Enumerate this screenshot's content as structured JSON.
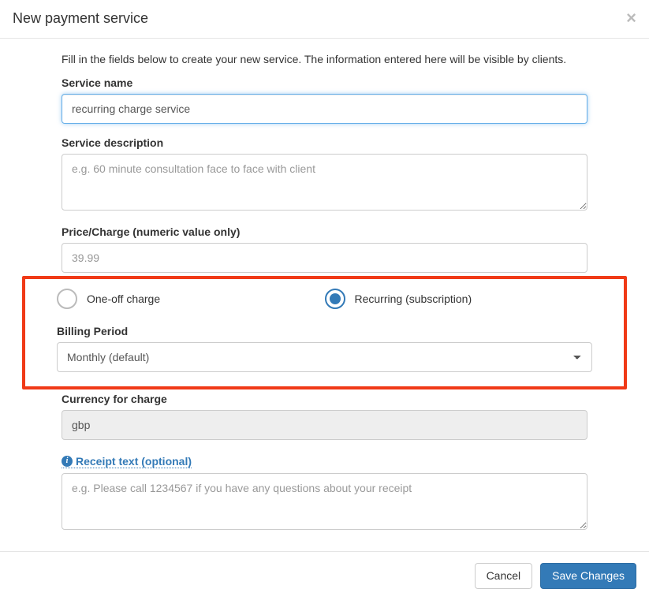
{
  "header": {
    "title": "New payment service",
    "close_glyph": "×"
  },
  "intro": "Fill in the fields below to create your new service. The information entered here will be visible by clients.",
  "svc_name": {
    "label": "Service name",
    "value": "recurring charge service"
  },
  "svc_desc": {
    "label": "Service description",
    "placeholder": "e.g. 60 minute consultation face to face with client",
    "value": ""
  },
  "price": {
    "label": "Price/Charge (numeric value only)",
    "placeholder": "39.99",
    "value": ""
  },
  "charge_type": {
    "one_off_label": "One-off charge",
    "recurring_label": "Recurring (subscription)",
    "selected": "recurring"
  },
  "billing_period": {
    "label": "Billing Period",
    "selected": "Monthly (default)"
  },
  "currency": {
    "label": "Currency for charge",
    "value": "gbp"
  },
  "receipt": {
    "label": "Receipt text (optional)",
    "placeholder": "e.g. Please call 1234567 if you have any questions about your receipt",
    "value": ""
  },
  "footer": {
    "cancel": "Cancel",
    "save": "Save Changes"
  }
}
